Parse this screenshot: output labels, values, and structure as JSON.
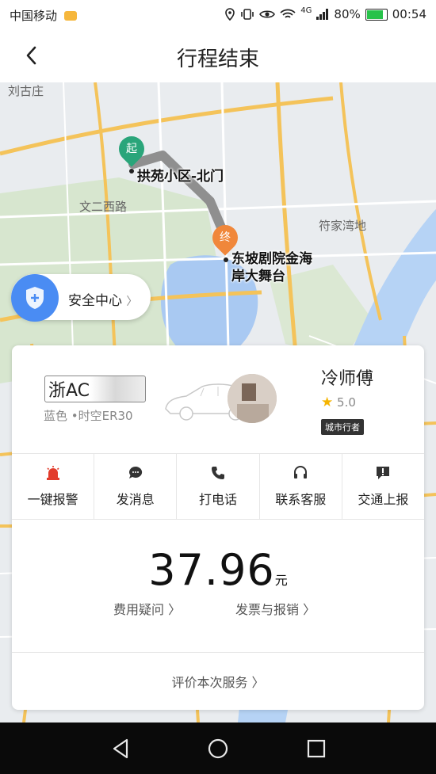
{
  "status_bar": {
    "carrier": "中国移动",
    "network": "4G",
    "battery": "80%",
    "battery_level": 0.8,
    "time": "00:54"
  },
  "header": {
    "title": "行程结束"
  },
  "map": {
    "place_labels": [
      "刘古庄",
      "文二西路",
      "符家湾地"
    ],
    "start_pin": "起",
    "end_pin": "终",
    "start_label": "拱苑小区-北门",
    "end_label_line1": "东坡剧院金海",
    "end_label_line2": "岸大舞台"
  },
  "safety": {
    "label": "安全中心",
    "arrow": "〉"
  },
  "driver": {
    "plate": "浙AC",
    "car_desc": "蓝色 •时空ER30",
    "name": "冷师傅",
    "rating": "5.0",
    "tag": "城市行者"
  },
  "actions": [
    {
      "label": "一键报警",
      "icon": "alarm-icon"
    },
    {
      "label": "发消息",
      "icon": "message-icon"
    },
    {
      "label": "打电话",
      "icon": "phone-icon"
    },
    {
      "label": "联系客服",
      "icon": "headset-icon"
    },
    {
      "label": "交通上报",
      "icon": "report-icon"
    }
  ],
  "fare": {
    "amount": "37.96",
    "unit": "元",
    "fee_question": "费用疑问 〉",
    "invoice": "发票与报销 〉"
  },
  "rate": {
    "label": "评价本次服务 〉"
  },
  "colors": {
    "start_pin": "#2aa57a",
    "end_pin": "#f0873a",
    "safety_blue": "#4a8cf3",
    "alarm_red": "#e23c2c",
    "star": "#f5b400"
  }
}
